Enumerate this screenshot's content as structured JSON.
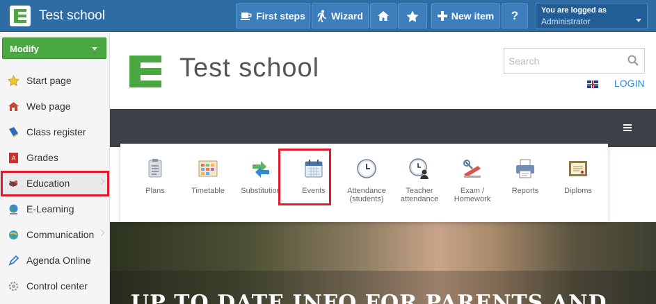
{
  "topbar": {
    "title": "Test school",
    "buttons": {
      "first_steps": "First steps",
      "wizard": "Wizard",
      "new_item": "New item",
      "help": "?"
    },
    "login": {
      "line1": "You are logged as",
      "line2": "Administrator"
    }
  },
  "sidebar": {
    "modify_label": "Modify",
    "items": [
      {
        "label": "Start page",
        "icon": "star-icon"
      },
      {
        "label": "Web page",
        "icon": "house-icon"
      },
      {
        "label": "Class register",
        "icon": "book-icon"
      },
      {
        "label": "Grades",
        "icon": "grades-icon"
      },
      {
        "label": "Education",
        "icon": "education-icon"
      },
      {
        "label": "E-Learning",
        "icon": "globe-icon"
      },
      {
        "label": "Communication",
        "icon": "communication-icon"
      },
      {
        "label": "Agenda Online",
        "icon": "pen-icon"
      },
      {
        "label": "Control center",
        "icon": "gear-icon"
      }
    ]
  },
  "site": {
    "title": "Test school",
    "search_placeholder": "Search",
    "login_link": "LOGIN",
    "hero_text": "UP TO DATE INFO FOR PARENTS AND"
  },
  "menu": {
    "items": [
      {
        "label": "Plans"
      },
      {
        "label": "Timetable"
      },
      {
        "label": "Substitution"
      },
      {
        "label": "Events"
      },
      {
        "label": "Attendance (students)"
      },
      {
        "label": "Teacher attendance"
      },
      {
        "label": "Exam / Homework"
      },
      {
        "label": "Reports"
      },
      {
        "label": "Diploms"
      }
    ]
  },
  "colors": {
    "topbar": "#2e6da4",
    "accent_green": "#4aa843",
    "highlight_red": "#e0192b",
    "navbar": "#3d4148",
    "link_blue": "#2e8bd0"
  }
}
